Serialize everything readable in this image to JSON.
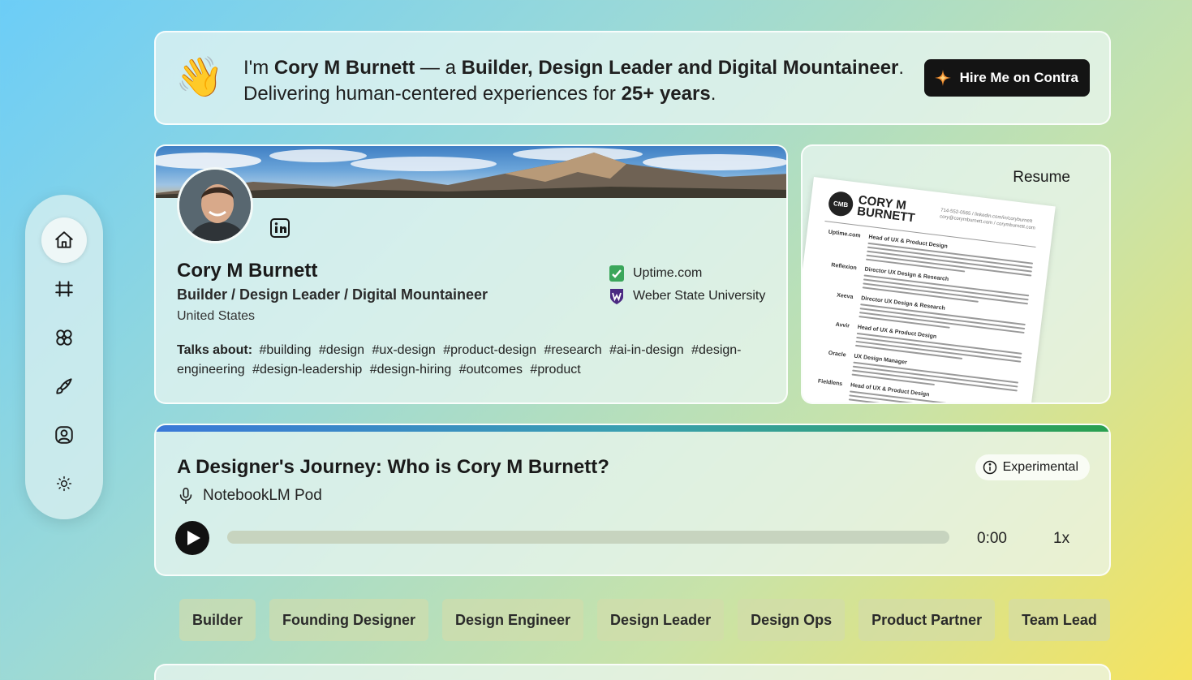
{
  "hero": {
    "emoji": "👋",
    "line1_a": "I'm ",
    "name": "Cory M Burnett",
    "line1_b": " — a ",
    "roles": "Builder, Design Leader and Digital Mountaineer",
    "line1_c": ".",
    "line2_a": "Delivering human-centered experiences for ",
    "years": "25+ years",
    "line2_b": ".",
    "hire_label": "Hire Me on Contra"
  },
  "profile": {
    "name": "Cory M Burnett",
    "title": "Builder / Design Leader / Digital Mountaineer",
    "location": "United States",
    "orgs": [
      {
        "name": "Uptime.com",
        "icon": "uptime-logo",
        "color": "#3aa65a"
      },
      {
        "name": "Weber State University",
        "icon": "weber-state-logo",
        "color": "#4b2a82"
      }
    ],
    "talks_label": "Talks about:",
    "tags": [
      "#building",
      "#design",
      "#ux-design",
      "#product-design",
      "#research",
      "#ai-in-design",
      "#design-engineering",
      "#design-leadership",
      "#design-hiring",
      "#outcomes",
      "#product"
    ]
  },
  "resume": {
    "label": "Resume",
    "monogram": "CMB",
    "name_line1": "CORY M",
    "name_line2": "BURNETT",
    "contact": "714-552-0565 / linkedin.com/in/coryburnett cory@corymburnett.com / corymburnett.com",
    "jobs": [
      {
        "company": "Uptime.com",
        "role": "Head of UX & Product Design"
      },
      {
        "company": "Reflexion",
        "role": "Director UX Design & Research"
      },
      {
        "company": "Xeeva",
        "role": "Director UX Design & Research"
      },
      {
        "company": "Avvir",
        "role": "Head of UX & Product Design"
      },
      {
        "company": "Oracle",
        "role": "UX Design Manager"
      },
      {
        "company": "Fieldlens",
        "role": "Head of UX & Product Design"
      }
    ]
  },
  "podcast": {
    "title": "A Designer's Journey: Who is Cory M Burnett?",
    "subtitle": "NotebookLM Pod",
    "badge": "Experimental",
    "time": "0:00",
    "speed": "1x",
    "progress": 0
  },
  "roles": [
    "Builder",
    "Founding Designer",
    "Design Engineer",
    "Design Leader",
    "Design Ops",
    "Product Partner",
    "Team Lead"
  ],
  "nav": [
    {
      "icon": "home-icon",
      "active": true
    },
    {
      "icon": "frame-icon",
      "active": false
    },
    {
      "icon": "brain-icon",
      "active": false
    },
    {
      "icon": "brush-icon",
      "active": false
    },
    {
      "icon": "user-circle-icon",
      "active": false
    },
    {
      "icon": "sun-icon",
      "active": false
    }
  ],
  "colors": {
    "accent_dark": "#141414",
    "contra_star": "#f08c2e",
    "podcast_gradient_start": "#3a78d8",
    "podcast_gradient_end": "#2aa050"
  }
}
